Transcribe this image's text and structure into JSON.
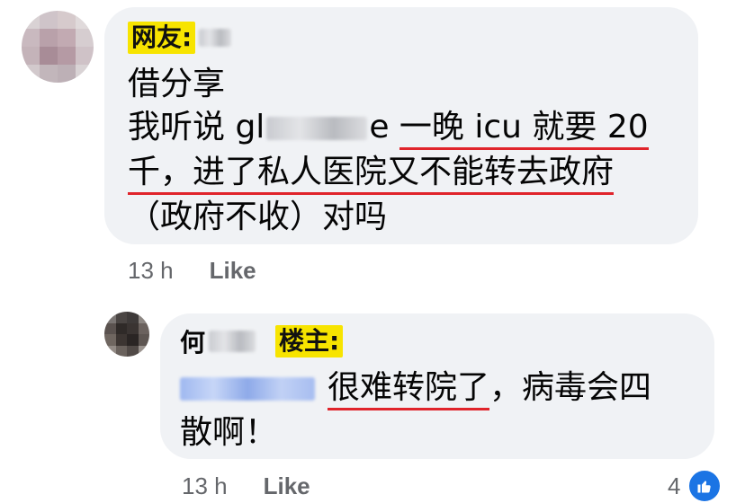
{
  "comment": {
    "tag": "网友:",
    "lines": [
      "借分享",
      "我听说 gl",
      "e",
      "一晚 icu 就要 20",
      "千，进了私人医院又不能转去政府",
      "（政府不收）对吗"
    ],
    "time": "13 h",
    "like_label": "Like"
  },
  "reply": {
    "name_prefix": "何",
    "tag": "楼主:",
    "text_underlined": "很难转院了",
    "text_rest": "，病毒会四",
    "line2": "散啊！",
    "time": "13 h",
    "like_label": "Like",
    "reaction_count": "4"
  },
  "colors": {
    "bubble_bg": "#f0f2f5",
    "tag_highlight": "#f7e400",
    "underline": "#e0242b",
    "meta_gray": "#65676b",
    "like_blue": "#1b74e4"
  }
}
